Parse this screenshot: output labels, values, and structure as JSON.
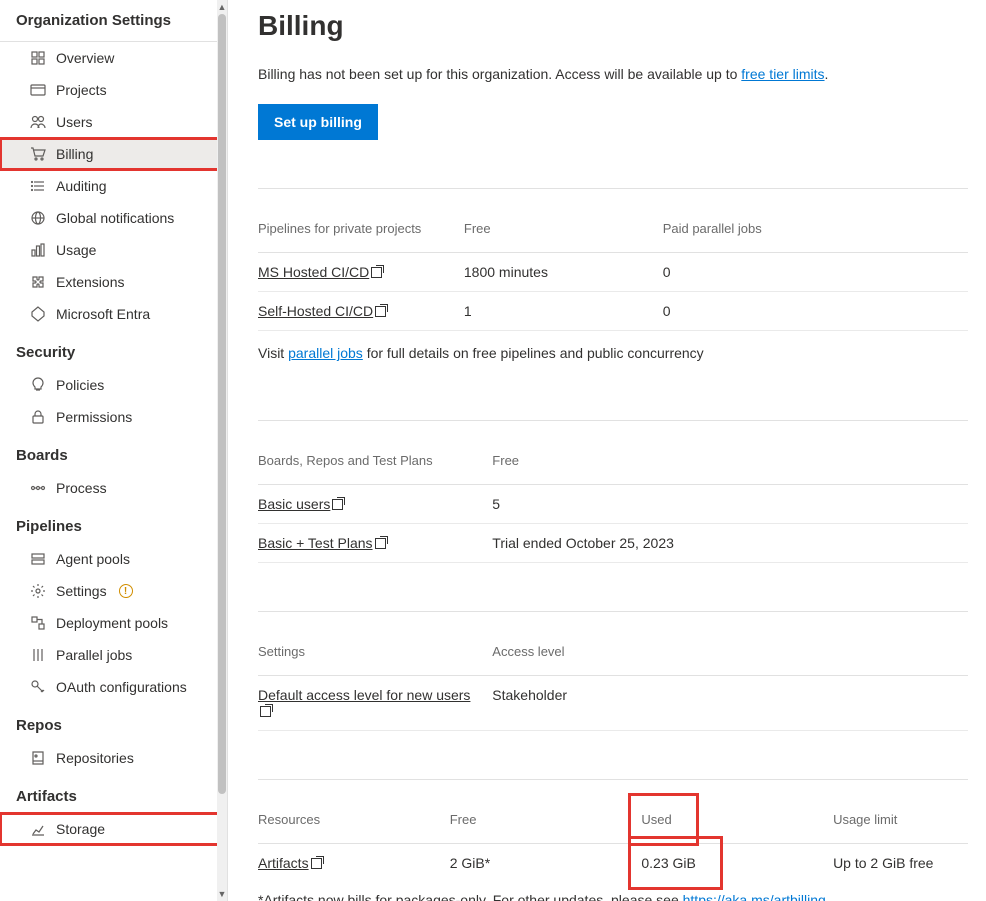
{
  "sidebar": {
    "title": "Organization Settings",
    "general": [
      {
        "icon": "grid",
        "label": "Overview"
      },
      {
        "icon": "card",
        "label": "Projects"
      },
      {
        "icon": "users",
        "label": "Users"
      },
      {
        "icon": "cart",
        "label": "Billing",
        "active": true,
        "highlight": true
      },
      {
        "icon": "list",
        "label": "Auditing"
      },
      {
        "icon": "globe",
        "label": "Global notifications"
      },
      {
        "icon": "bars",
        "label": "Usage"
      },
      {
        "icon": "puzzle",
        "label": "Extensions"
      },
      {
        "icon": "entra",
        "label": "Microsoft Entra"
      }
    ],
    "groups": [
      {
        "title": "Security",
        "items": [
          {
            "icon": "bulb",
            "label": "Policies"
          },
          {
            "icon": "lock",
            "label": "Permissions"
          }
        ]
      },
      {
        "title": "Boards",
        "items": [
          {
            "icon": "process",
            "label": "Process"
          }
        ]
      },
      {
        "title": "Pipelines",
        "items": [
          {
            "icon": "pool",
            "label": "Agent pools"
          },
          {
            "icon": "gear",
            "label": "Settings",
            "warn": true
          },
          {
            "icon": "deploy",
            "label": "Deployment pools"
          },
          {
            "icon": "parallel",
            "label": "Parallel jobs"
          },
          {
            "icon": "key",
            "label": "OAuth configurations"
          }
        ]
      },
      {
        "title": "Repos",
        "items": [
          {
            "icon": "repo",
            "label": "Repositories"
          }
        ]
      },
      {
        "title": "Artifacts",
        "items": [
          {
            "icon": "chart",
            "label": "Storage",
            "highlight": true
          }
        ]
      }
    ]
  },
  "page": {
    "title": "Billing",
    "intro_pre": "Billing has not been set up for this organization. Access will be available up to ",
    "intro_link": "free tier limits",
    "intro_post": ".",
    "setup_button": "Set up billing"
  },
  "pipelines_table": {
    "h1": "Pipelines for private projects",
    "h2": "Free",
    "h3": "Paid parallel jobs",
    "rows": [
      {
        "label": "MS Hosted CI/CD",
        "link": true,
        "free": "1800 minutes",
        "paid": "0"
      },
      {
        "label": "Self-Hosted CI/CD",
        "link": true,
        "free": "1",
        "paid": "0"
      }
    ],
    "foot_pre": "Visit ",
    "foot_link": "parallel jobs",
    "foot_post": " for full details on free pipelines and public concurrency"
  },
  "boards_table": {
    "h1": "Boards, Repos and Test Plans",
    "h2": "Free",
    "rows": [
      {
        "label": "Basic users",
        "link": true,
        "free": "5"
      },
      {
        "label": "Basic + Test Plans",
        "link": true,
        "free": "Trial ended October 25, 2023"
      }
    ]
  },
  "settings_table": {
    "h1": "Settings",
    "h2": "Access level",
    "rows": [
      {
        "label": "Default access level for new users",
        "link": true,
        "value": "Stakeholder"
      }
    ]
  },
  "resources_table": {
    "h1": "Resources",
    "h2": "Free",
    "h3": "Used",
    "h4": "Usage limit",
    "row": {
      "label": "Artifacts",
      "free": "2 GiB*",
      "used": "0.23 GiB",
      "limit": "Up to 2 GiB free"
    },
    "foot_pre": "*Artifacts now bills for packages-only. For other updates, please see ",
    "foot_link": "https://aka.ms/artbilling",
    "foot_post": "."
  }
}
